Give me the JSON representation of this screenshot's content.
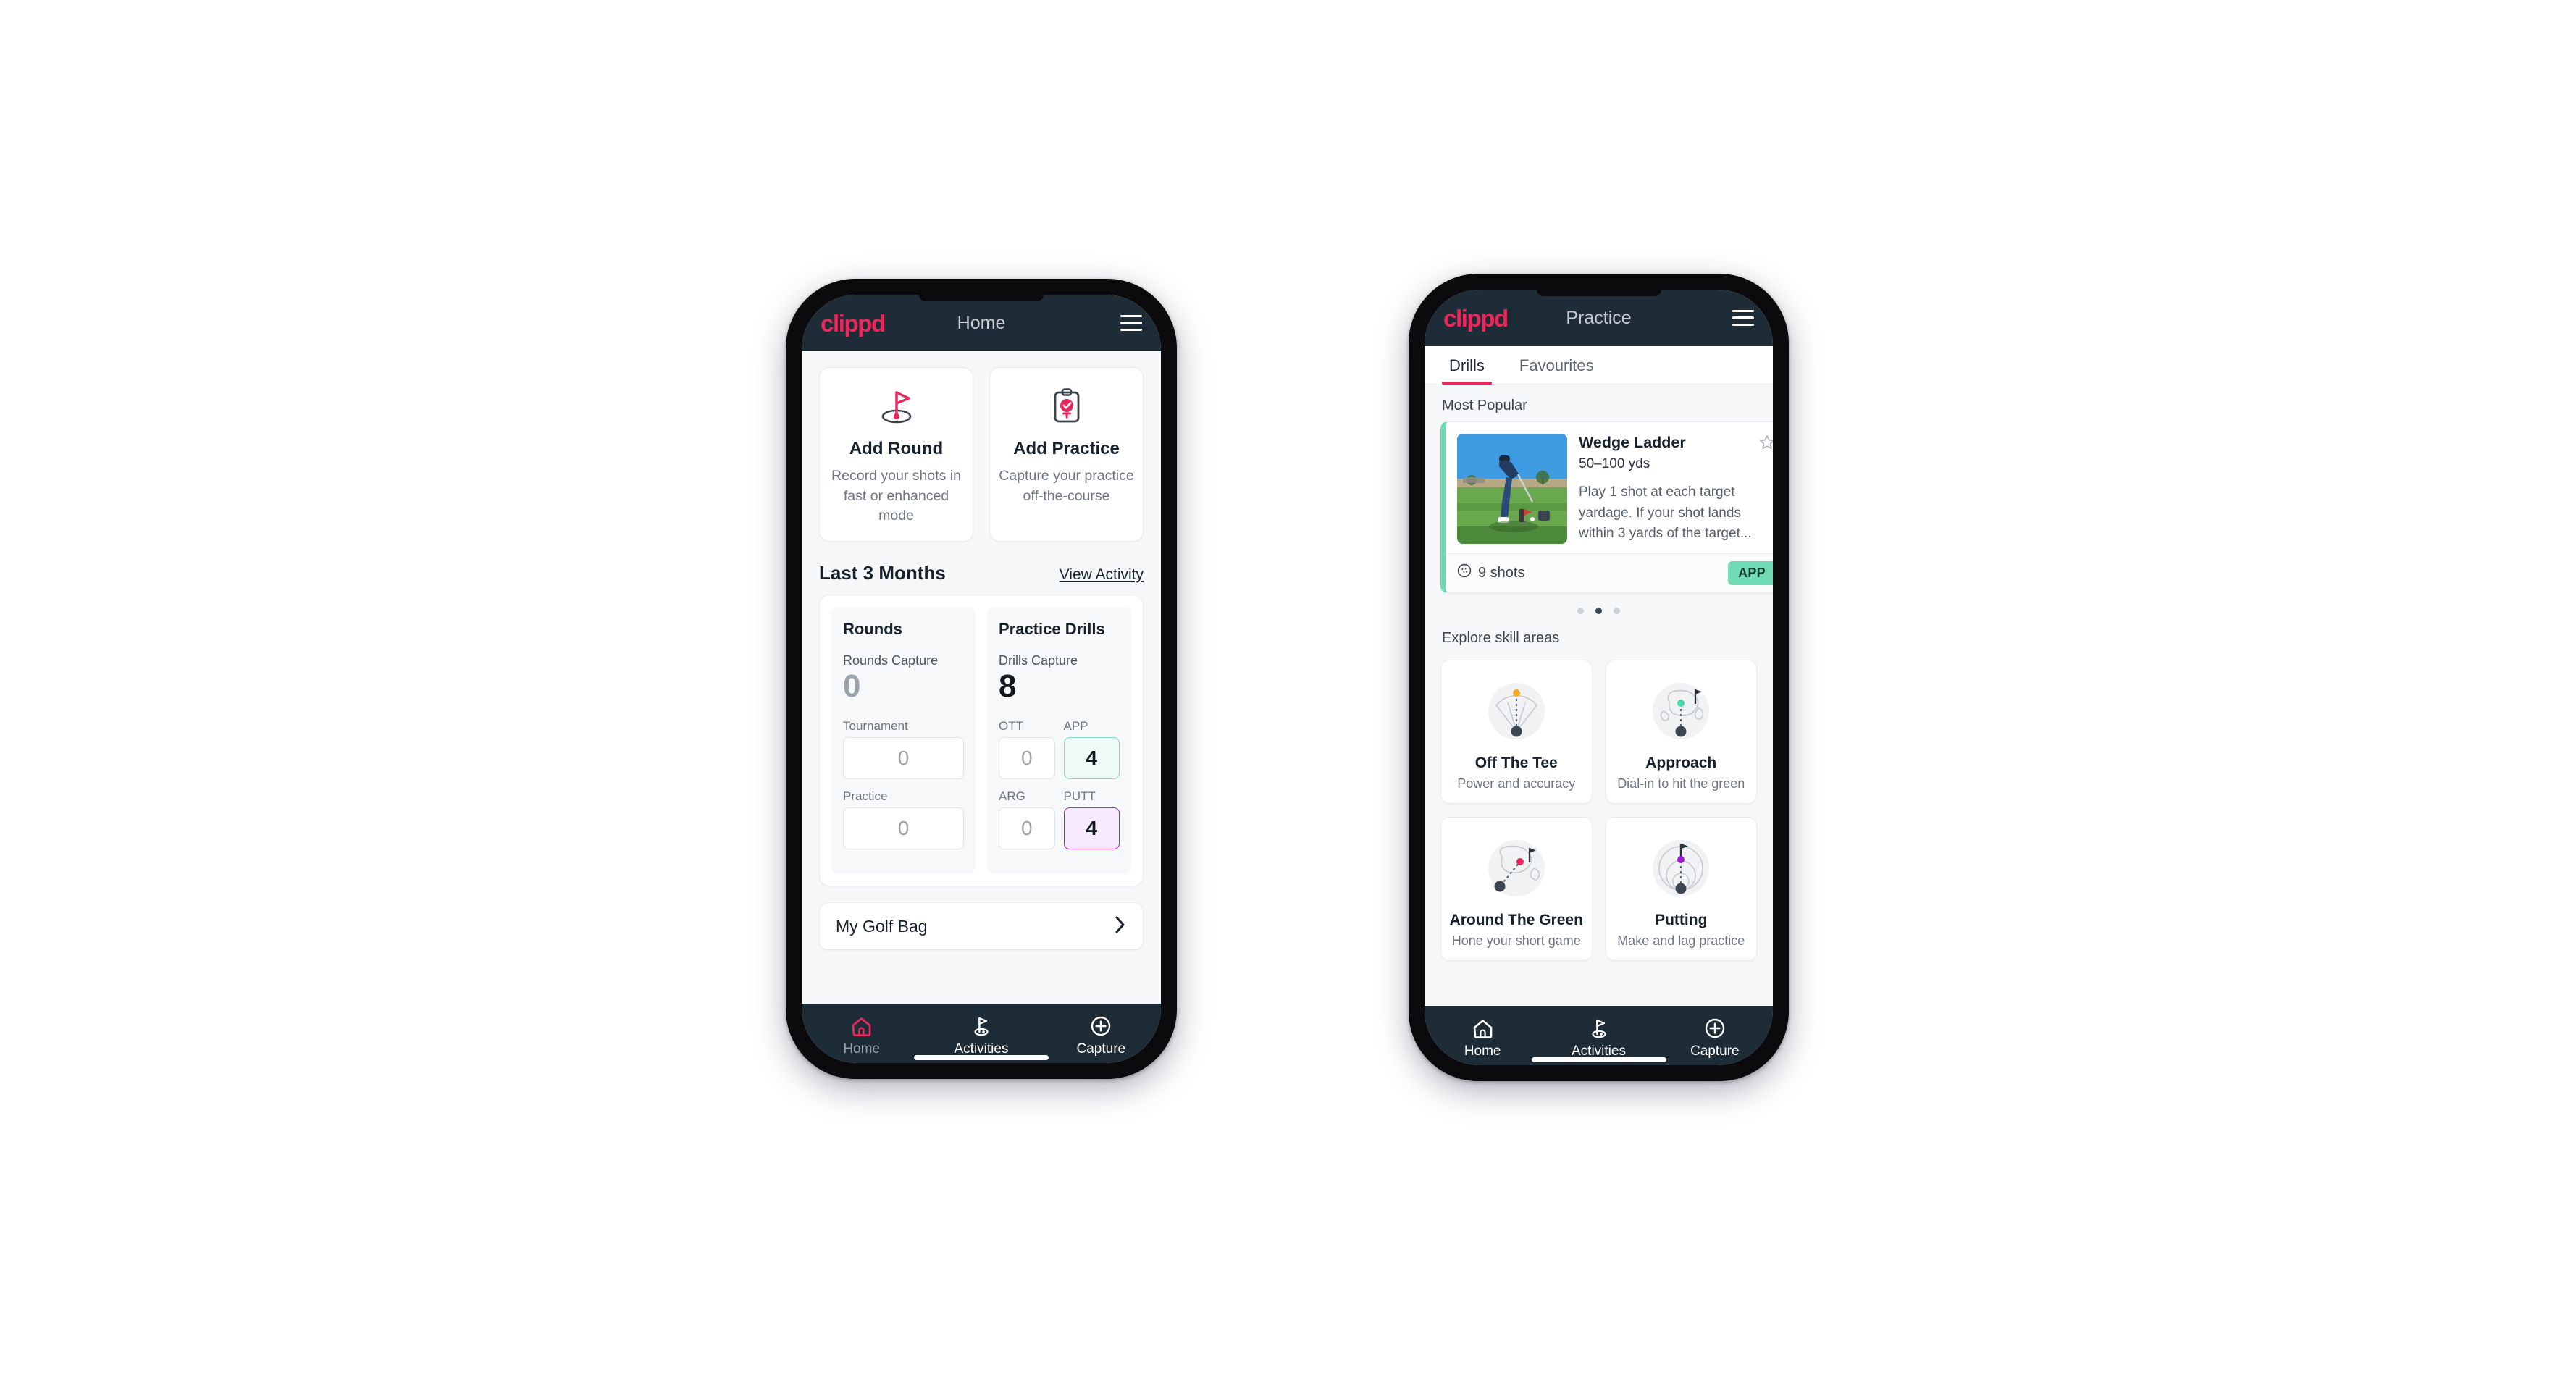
{
  "phone_home": {
    "appbar": {
      "logo": "clippd",
      "title": "Home",
      "menu_icon": "hamburger-menu-icon"
    },
    "quick_actions": [
      {
        "icon": "golf-flag-hole-icon",
        "title": "Add Round",
        "subtitle": "Record your shots in fast or enhanced mode"
      },
      {
        "icon": "clipboard-check-tee-icon",
        "title": "Add Practice",
        "subtitle": "Capture your practice off-the-course"
      }
    ],
    "section": {
      "title": "Last 3 Months",
      "link": "View Activity"
    },
    "rounds_pane": {
      "title": "Rounds",
      "capture_label": "Rounds Capture",
      "capture_value": "0",
      "fields": [
        {
          "label": "Tournament",
          "value": "0",
          "accent": "none"
        },
        {
          "label": "Practice",
          "value": "0",
          "accent": "none"
        }
      ]
    },
    "drills_pane": {
      "title": "Practice Drills",
      "capture_label": "Drills Capture",
      "capture_value": "8",
      "fields": [
        {
          "label": "OTT",
          "value": "0",
          "accent": "none"
        },
        {
          "label": "APP",
          "value": "4",
          "accent": "teal"
        },
        {
          "label": "ARG",
          "value": "0",
          "accent": "none"
        },
        {
          "label": "PUTT",
          "value": "4",
          "accent": "purple"
        }
      ]
    },
    "golf_bag": {
      "label": "My Golf Bag",
      "chevron_icon": "chevron-right-icon"
    },
    "bottom_nav": [
      {
        "icon": "home-icon",
        "label": "Home",
        "active": true
      },
      {
        "icon": "golf-flag-icon",
        "label": "Activities",
        "active": false
      },
      {
        "icon": "plus-circle-icon",
        "label": "Capture",
        "active": false
      }
    ]
  },
  "phone_practice": {
    "appbar": {
      "logo": "clippd",
      "title": "Practice",
      "menu_icon": "hamburger-menu-icon"
    },
    "tabs": [
      {
        "label": "Drills",
        "active": true
      },
      {
        "label": "Favourites",
        "active": false
      }
    ],
    "most_popular_label": "Most Popular",
    "drill_card": {
      "thumb_icon": "golfer-practice-photo",
      "title": "Wedge Ladder",
      "yardage": "50–100 yds",
      "description": "Play 1 shot at each target yardage. If your shot lands within 3 yards of the target...",
      "favourite_icon": "star-outline-icon",
      "shots_icon": "golf-ball-icon",
      "shots": "9 shots",
      "badge": "APP",
      "accent_color": "#67ddb2",
      "next_card_accent": "#b01fe0"
    },
    "carousel_dots": {
      "count": 3,
      "active_index": 1
    },
    "explore_label": "Explore skill areas",
    "skill_areas": [
      {
        "icon": "tee-shot-dispersion-icon",
        "name": "Off The Tee",
        "subtitle": "Power and accuracy",
        "color": "#f5a623"
      },
      {
        "icon": "approach-green-icon",
        "name": "Approach",
        "subtitle": "Dial-in to hit the green",
        "color": "#4ad6a8"
      },
      {
        "icon": "chip-around-green-icon",
        "name": "Around The Green",
        "subtitle": "Hone your short game",
        "color": "#e8275a"
      },
      {
        "icon": "putting-rings-icon",
        "name": "Putting",
        "subtitle": "Make and lag practice",
        "color": "#9b1fd0"
      }
    ],
    "bottom_nav": [
      {
        "icon": "home-icon",
        "label": "Home",
        "active": false
      },
      {
        "icon": "golf-flag-icon",
        "label": "Activities",
        "active": false
      },
      {
        "icon": "plus-circle-icon",
        "label": "Capture",
        "active": false
      }
    ]
  },
  "theme": {
    "brand_pink": "#e8275a",
    "appbar_dark": "#1e2c38",
    "page_bg": "#f6f7f8",
    "accent_teal": "#67ddb2",
    "accent_purple": "#a21fd4"
  }
}
